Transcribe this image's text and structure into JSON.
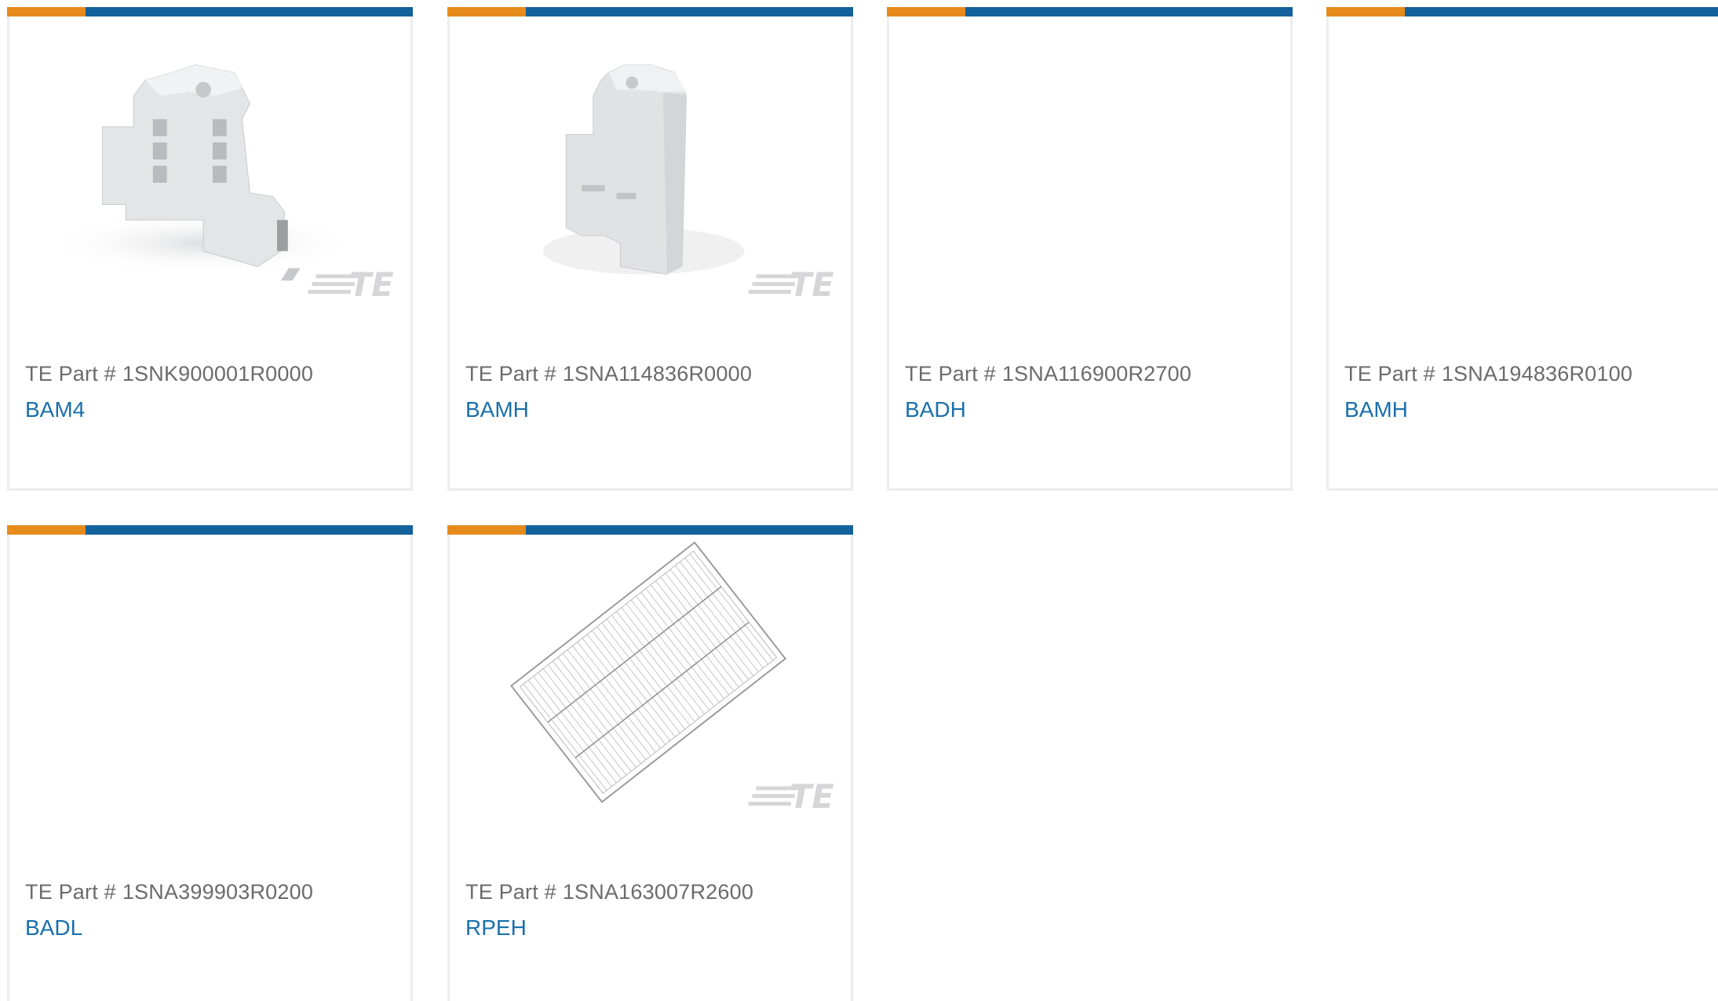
{
  "colors": {
    "accent_orange": "#e68a1c",
    "accent_blue": "#13629c",
    "link": "#1a70ab",
    "text_muted": "#6b6b6b",
    "border": "#eceded"
  },
  "part_prefix": "TE Part #",
  "products": [
    {
      "part_number": "1SNK900001R0000",
      "name": "BAM4",
      "image": "end-bracket-wide-icon"
    },
    {
      "part_number": "1SNA114836R0000",
      "name": "BAMH",
      "image": "end-bracket-narrow-icon"
    },
    {
      "part_number": "1SNA116900R2700",
      "name": "BADH",
      "image": ""
    },
    {
      "part_number": "1SNA194836R0100",
      "name": "BAMH",
      "image": ""
    },
    {
      "part_number": "1SNA399903R0200",
      "name": "BADL",
      "image": ""
    },
    {
      "part_number": "1SNA163007R2600",
      "name": "RPEH",
      "image": "marker-sheet-icon"
    }
  ]
}
